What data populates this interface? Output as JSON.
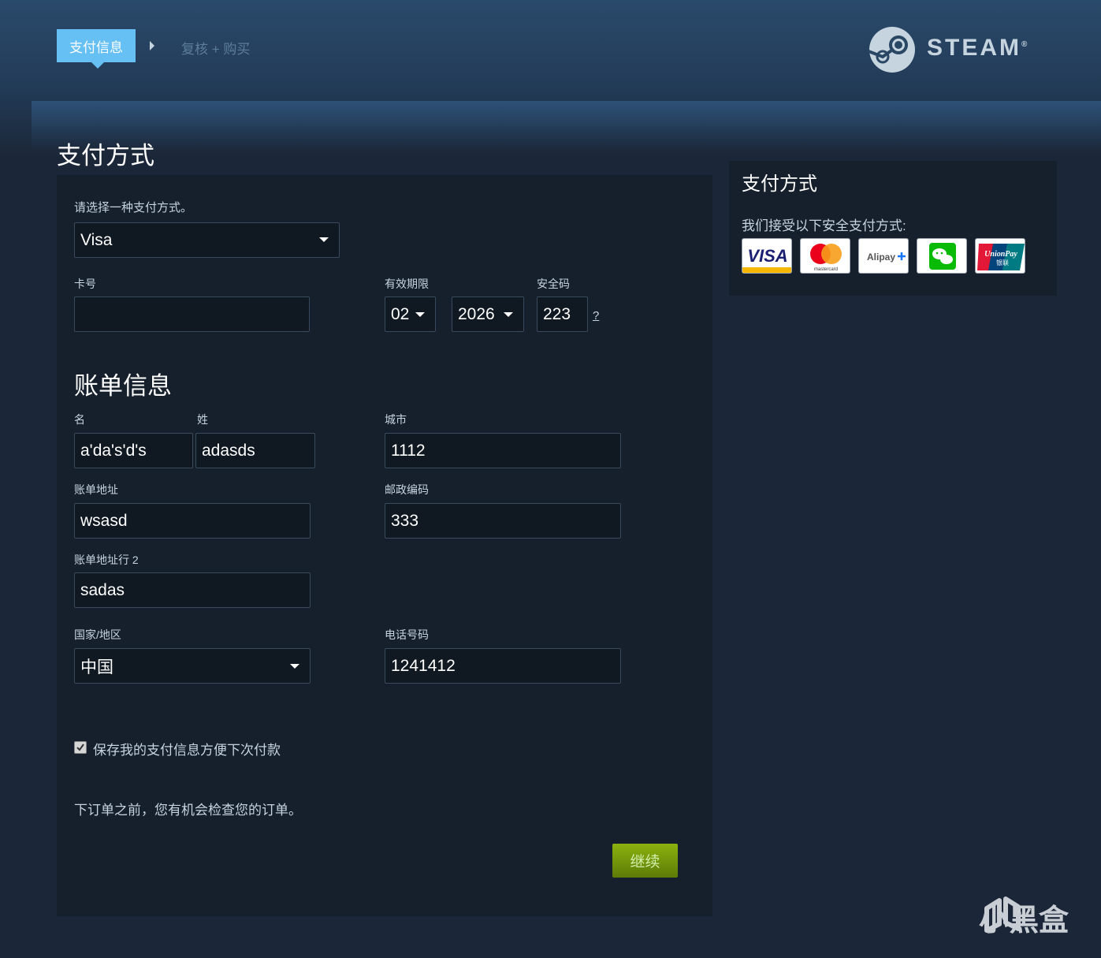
{
  "breadcrumb": {
    "step1": "支付信息",
    "step2": "复核 + 购买"
  },
  "brand": {
    "name": "STEAM",
    "reg": "®"
  },
  "page": {
    "title": "支付方式"
  },
  "payment": {
    "choose_label": "请选择一种支付方式。",
    "method": "Visa",
    "card_number_label": "卡号",
    "card_number": "",
    "expiry_label": "有效期限",
    "expiry_month": "02",
    "expiry_year": "2026",
    "cvv_label": "安全码",
    "cvv": "223",
    "cvv_help": "?"
  },
  "billing": {
    "title": "账单信息",
    "first_name_label": "名",
    "first_name": "a'da's'd's",
    "last_name_label": "姓",
    "last_name": "adasds",
    "city_label": "城市",
    "city": "1112",
    "address_label": "账单地址",
    "address": "wsasd",
    "zip_label": "邮政编码",
    "zip": "333",
    "address2_label": "账单地址行 2",
    "address2": "sadas",
    "country_label": "国家/地区",
    "country": "中国",
    "phone_label": "电话号码",
    "phone": "1241412"
  },
  "save_info": {
    "label": "保存我的支付信息方便下次付款",
    "checked": true
  },
  "notice": "下订单之前，您有机会检查您的订单。",
  "continue_label": "继续",
  "side": {
    "title": "支付方式",
    "text": "我们接受以下安全支付方式:",
    "methods": [
      "VISA",
      "mastercard",
      "Alipay",
      "WeChat",
      "UnionPay 银联"
    ],
    "visa_text": "VISA",
    "mc_text": "mastercard",
    "alipay_text": "Alipay",
    "unionpay_text": "UnionPay",
    "unionpay_cn": "银联"
  },
  "watermark": "小黑盒",
  "colors": {
    "accent": "#66c0f4",
    "button": "#8bb20e",
    "panel": "#16202d",
    "background": "#1b2738"
  }
}
